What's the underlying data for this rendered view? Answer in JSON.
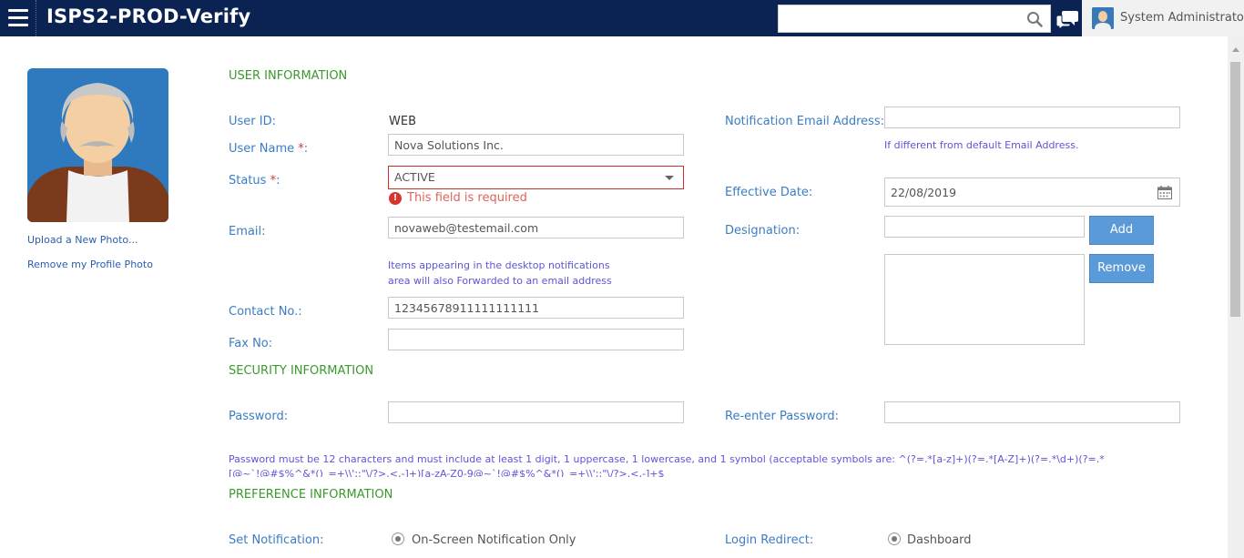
{
  "header": {
    "app_title": "ISPS2-PROD-Verify",
    "search_placeholder": "",
    "user_name": "System Administrator",
    "background_color": "#0b2353"
  },
  "profile": {
    "upload_link": "Upload a New Photo...",
    "remove_link": "Remove my Profile Photo"
  },
  "user_info": {
    "section_title": "USER INFORMATION",
    "user_id_label": "User ID:",
    "user_id_value": "WEB",
    "user_name_label": "User Name",
    "user_name_value": "Nova Solutions Inc.",
    "status_label": "Status",
    "status_value": "ACTIVE",
    "status_error": "This field is required",
    "email_label": "Email:",
    "email_value": "novaweb@testemail.com",
    "email_hint_line1": "Items appearing in the desktop notifications",
    "email_hint_line2": "area will also Forwarded to an email address",
    "contact_label": "Contact No.:",
    "contact_value": "12345678911111111111",
    "fax_label": "Fax No:",
    "fax_value": "",
    "notification_email_label": "Notification Email Address:",
    "notification_email_value": "",
    "notification_email_hint": "If different from default Email Address.",
    "effective_date_label": "Effective Date:",
    "effective_date_value": "22/08/2019",
    "designation_label": "Designation:",
    "designation_value": "",
    "add_button": "Add",
    "remove_button": "Remove"
  },
  "security_info": {
    "section_title": "SECURITY INFORMATION",
    "password_label": "Password:",
    "reenter_label": "Re-enter Password:",
    "password_note": "Password must be 12 characters and must include at least 1 digit, 1 uppercase, 1 lowercase, and 1 symbol (acceptable symbols are: ^(?=.*[a-z]+)(?=.*[A-Z]+)(?=.*\\d+)(?=.*[@~`!@#$%^&*()_=+\\\\';:\"\\/?>.<,-]+)[a-zA-Z0-9@~`!@#$%^&*()_=+\\\\';:\"\\/?>.<,-]+$"
  },
  "preference_info": {
    "section_title": "PREFERENCE INFORMATION",
    "set_notification_label": "Set Notification:",
    "set_notification_option": "On-Screen Notification Only",
    "login_redirect_label": "Login Redirect:",
    "login_redirect_option": "Dashboard"
  },
  "colors": {
    "label_blue": "#3b7dc4",
    "section_green": "#3a9a2c",
    "required_red": "#d9342b",
    "button_blue": "#5b9ad8"
  },
  "icons": [
    "menu-icon",
    "search-icon",
    "chat-icon",
    "user-avatar-icon",
    "error-icon",
    "calendar-icon",
    "chevron-down-icon"
  ]
}
